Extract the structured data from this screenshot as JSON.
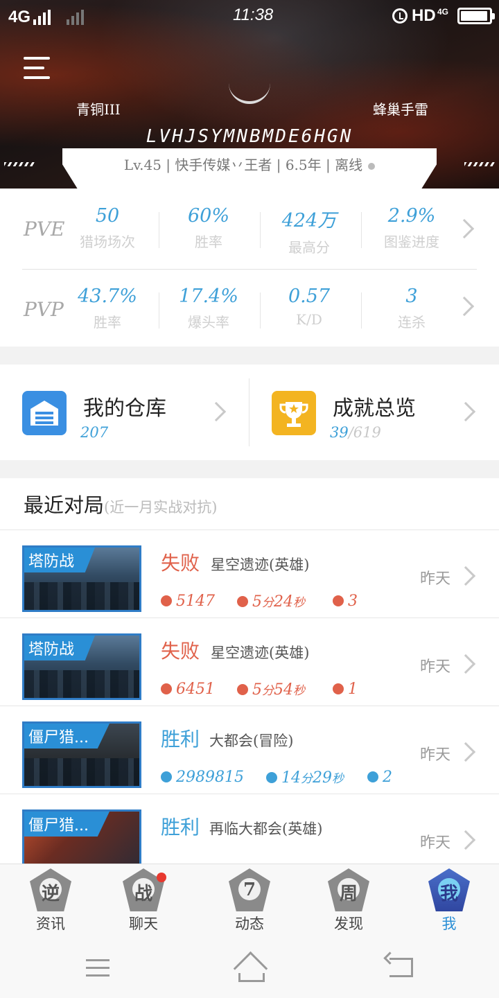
{
  "status_bar": {
    "network": "4G",
    "time": "11:38",
    "hd": "HD",
    "net_small": "4G"
  },
  "profile": {
    "rank": "青铜III",
    "team": "蜂巢手雷",
    "name": "LVHJSYMNBMDE6HGN",
    "info": "Lv.45 | 快手传媒丷王者 | 6.5年 | 离线"
  },
  "pve": {
    "label": "PVE",
    "stats": [
      {
        "value": "50",
        "label": "猎场场次"
      },
      {
        "value": "60%",
        "label": "胜率"
      },
      {
        "value": "424万",
        "label": "最高分"
      },
      {
        "value": "2.9%",
        "label": "图鉴进度"
      }
    ]
  },
  "pvp": {
    "label": "PVP",
    "stats": [
      {
        "value": "43.7%",
        "label": "胜率"
      },
      {
        "value": "17.4%",
        "label": "爆头率"
      },
      {
        "value": "0.57",
        "label": "K/D"
      },
      {
        "value": "3",
        "label": "连杀"
      }
    ]
  },
  "warehouse": {
    "title": "我的仓库",
    "count": "207"
  },
  "achievements": {
    "title": "成就总览",
    "done": "39",
    "total": "/619"
  },
  "recent": {
    "title": "最近对局",
    "subtitle": "(近一月实战对抗)",
    "matches": [
      {
        "mode": "塔防战",
        "result": "失败",
        "map": "星空遗迹(英雄)",
        "score": "5147",
        "dur_min": "5",
        "dur_sec": "24",
        "kills": "3",
        "when": "昨天",
        "outcome": "lose"
      },
      {
        "mode": "塔防战",
        "result": "失败",
        "map": "星空遗迹(英雄)",
        "score": "6451",
        "dur_min": "5",
        "dur_sec": "54",
        "kills": "1",
        "when": "昨天",
        "outcome": "lose"
      },
      {
        "mode": "僵尸猎...",
        "result": "胜利",
        "map": "大都会(冒险)",
        "score": "2989815",
        "dur_min": "14",
        "dur_sec": "29",
        "kills": "2",
        "when": "昨天",
        "outcome": "win"
      },
      {
        "mode": "僵尸猎...",
        "result": "胜利",
        "map": "再临大都会(英雄)",
        "score": "",
        "dur_min": "",
        "dur_sec": "",
        "kills": "",
        "when": "昨天",
        "outcome": "win"
      }
    ],
    "unit_min": "分",
    "unit_sec": "秒"
  },
  "tabs": [
    {
      "glyph": "逆",
      "label": "资讯"
    },
    {
      "glyph": "战",
      "label": "聊天"
    },
    {
      "glyph": "7",
      "label": "动态"
    },
    {
      "glyph": "周",
      "label": "发现"
    },
    {
      "glyph": "我",
      "label": "我"
    }
  ],
  "colors": {
    "accent_blue": "#3ea0d8",
    "lose_red": "#e0614a",
    "badge_red": "#e8392f",
    "gold": "#f3b421"
  }
}
